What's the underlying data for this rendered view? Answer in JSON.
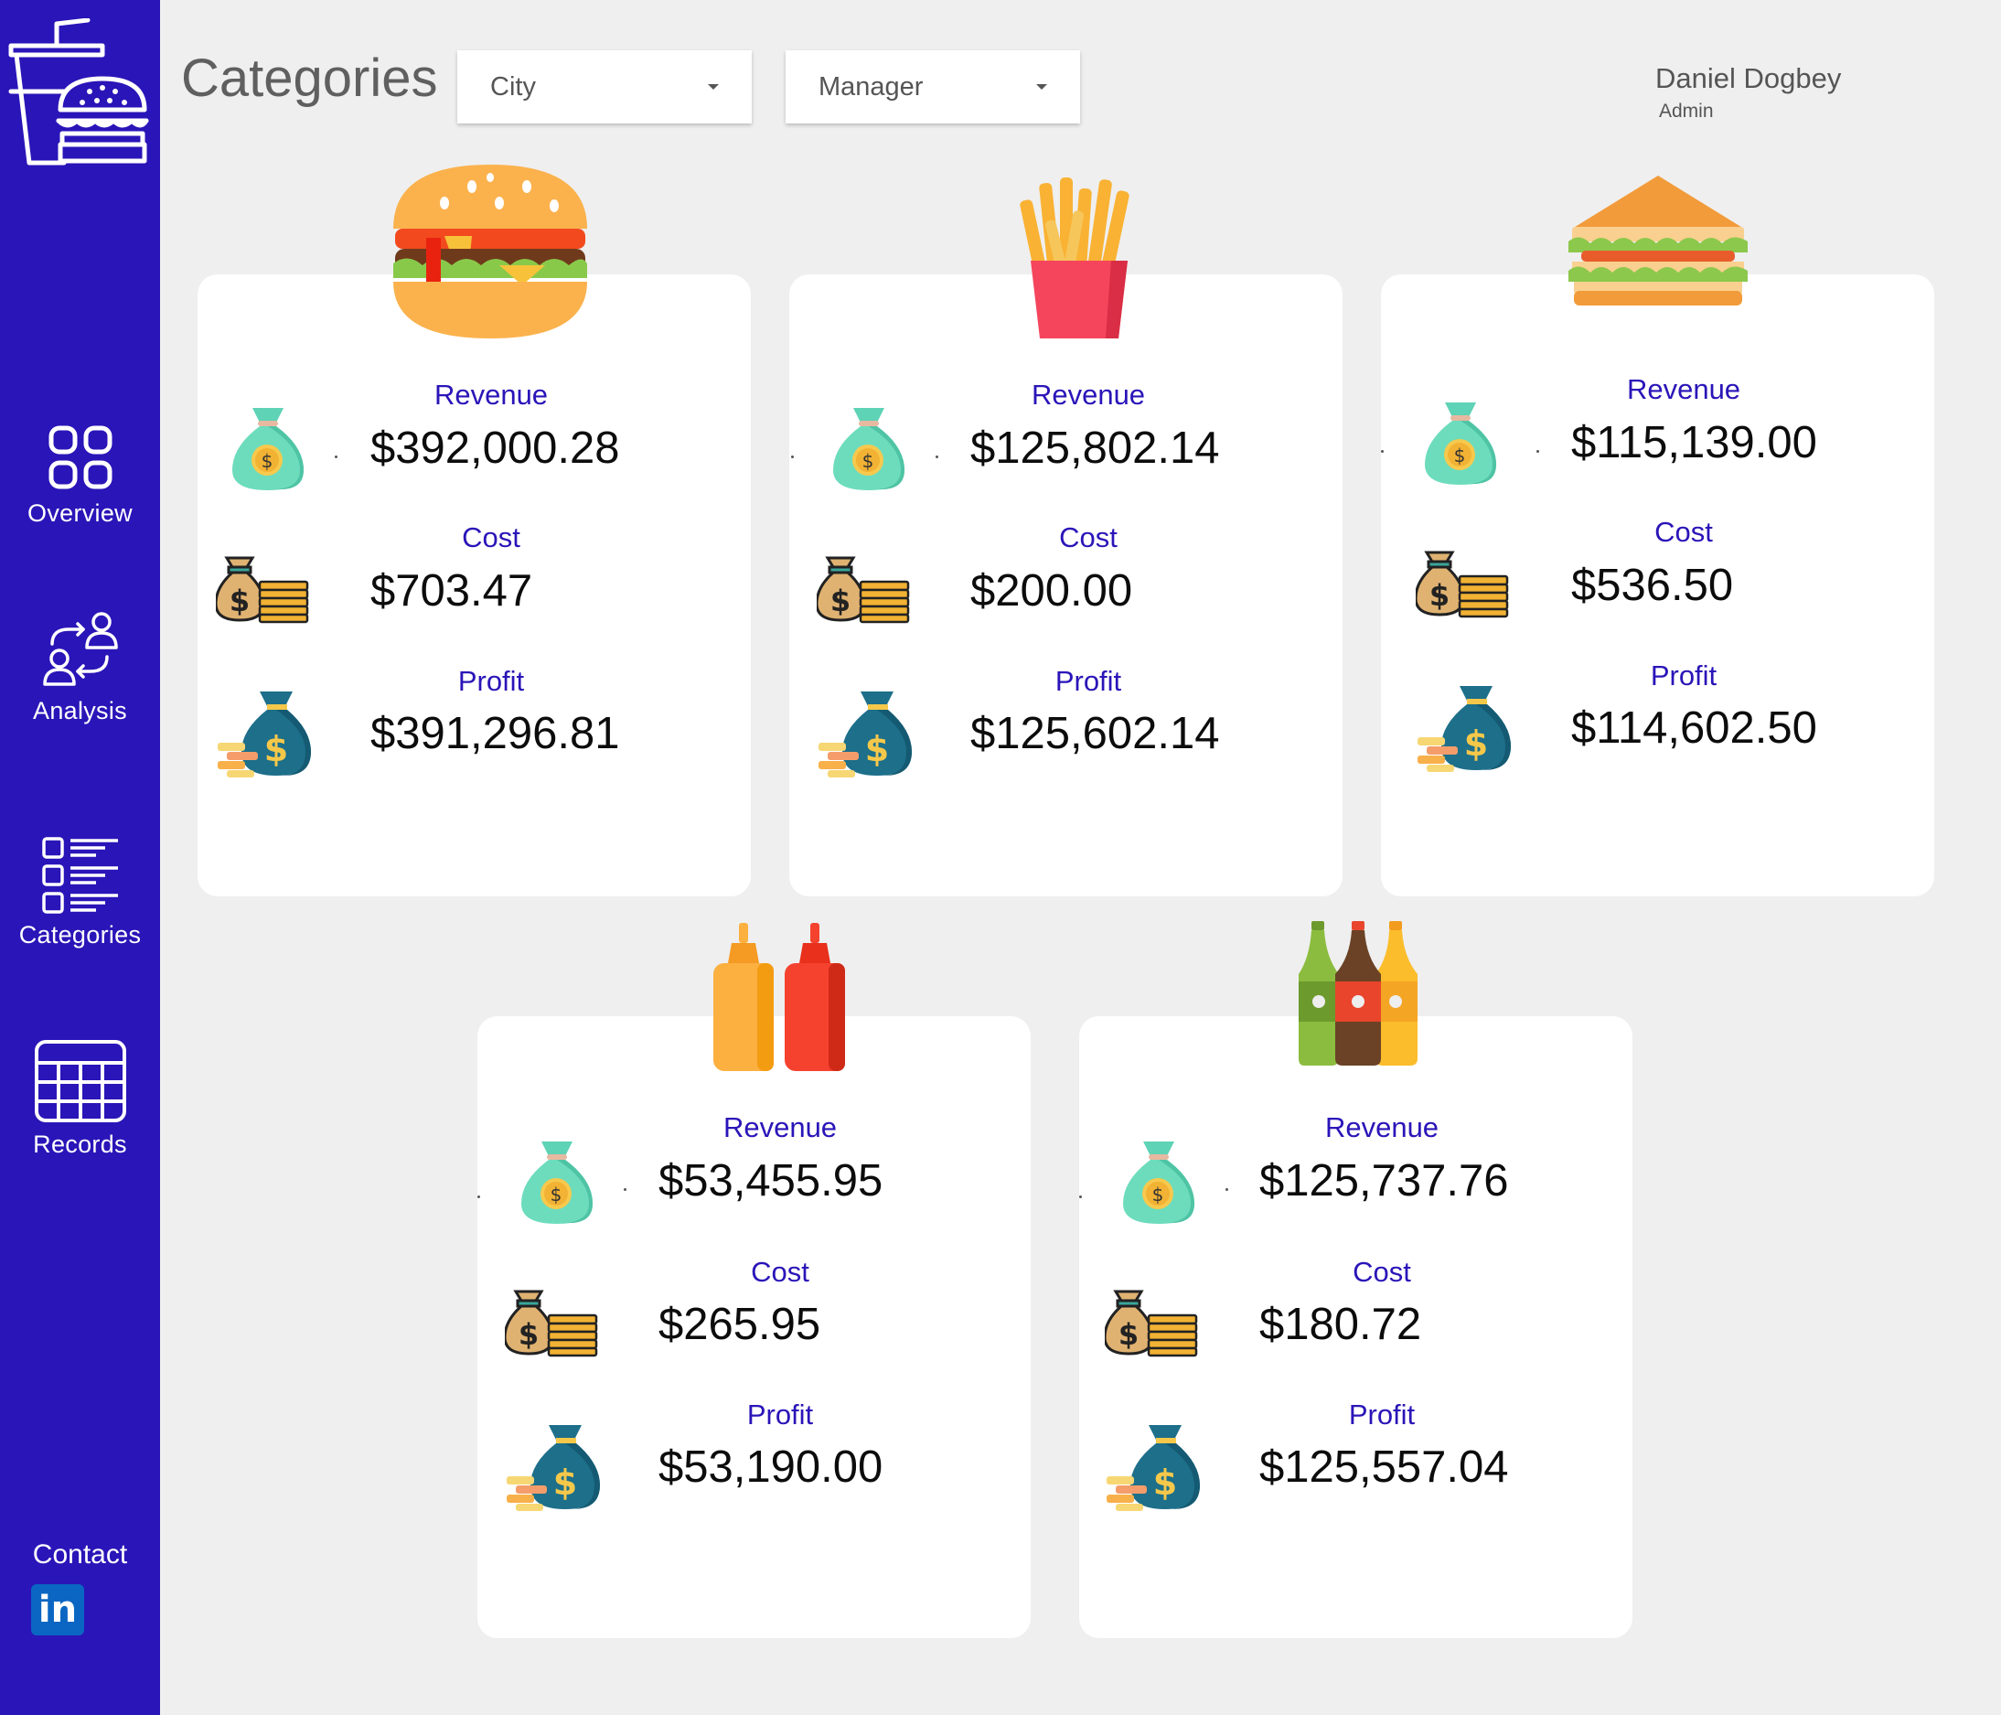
{
  "page": {
    "title": "Categories"
  },
  "filters": {
    "city": {
      "value": "City"
    },
    "manager": {
      "value": "Manager"
    }
  },
  "user": {
    "name": "Daniel Dogbey",
    "role": "Admin"
  },
  "sidebar": {
    "logo_icon": "fastfood-logo-icon",
    "items": [
      {
        "label": "Overview",
        "icon": "overview-icon"
      },
      {
        "label": "Analysis",
        "icon": "analysis-icon"
      },
      {
        "label": "Categories",
        "icon": "categories-icon"
      },
      {
        "label": "Records",
        "icon": "records-icon"
      }
    ],
    "contact": {
      "label": "Contact",
      "icon": "linkedin-icon"
    }
  },
  "colors": {
    "sidebar": "#2a15b8",
    "label": "#2a15b8",
    "background": "#efefef",
    "card": "#ffffff"
  },
  "cards": [
    {
      "icon": "burger-icon",
      "revenue_label": "Revenue",
      "revenue": "$392,000.28",
      "cost_label": "Cost",
      "cost": "$703.47",
      "profit_label": "Profit",
      "profit": "$391,296.81"
    },
    {
      "icon": "fries-icon",
      "revenue_label": "Revenue",
      "revenue": "$125,802.14",
      "cost_label": "Cost",
      "cost": "$200.00",
      "profit_label": "Profit",
      "profit": "$125,602.14"
    },
    {
      "icon": "sandwich-icon",
      "revenue_label": "Revenue",
      "revenue": "$115,139.00",
      "cost_label": "Cost",
      "cost": "$536.50",
      "profit_label": "Profit",
      "profit": "$114,602.50"
    },
    {
      "icon": "sauce-bottles-icon",
      "revenue_label": "Revenue",
      "revenue": "$53,455.95",
      "cost_label": "Cost",
      "cost": "$265.95",
      "profit_label": "Profit",
      "profit": "$53,190.00"
    },
    {
      "icon": "soda-bottles-icon",
      "revenue_label": "Revenue",
      "revenue": "$125,737.76",
      "cost_label": "Cost",
      "cost": "$180.72",
      "profit_label": "Profit",
      "profit": "$125,557.04"
    }
  ]
}
